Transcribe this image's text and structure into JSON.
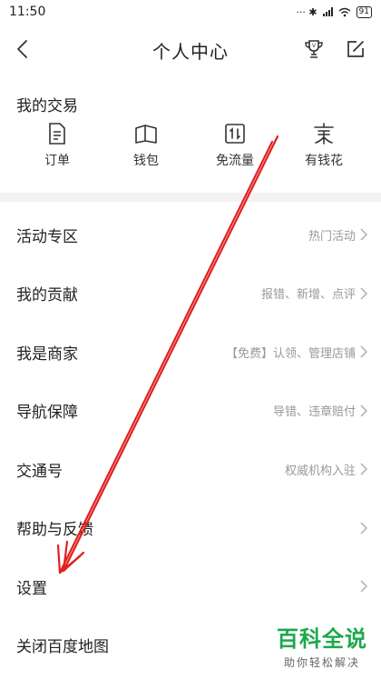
{
  "status_bar": {
    "time": "11:50",
    "icons_text": "··· ✱",
    "battery": "91"
  },
  "header": {
    "title": "个人中心",
    "back_icon": "back-arrow-icon",
    "trophy_icon": "trophy-icon",
    "edit_icon": "edit-icon"
  },
  "trade": {
    "title": "我的交易",
    "items": [
      {
        "label": "订单",
        "icon": "document-icon"
      },
      {
        "label": "钱包",
        "icon": "wallet-icon"
      },
      {
        "label": "免流量",
        "icon": "data-free-icon"
      },
      {
        "label": "有钱花",
        "icon": "youqianhua-icon"
      }
    ]
  },
  "menu": [
    {
      "label": "活动专区",
      "desc": "热门活动"
    },
    {
      "label": "我的贡献",
      "desc": "报错、新增、点评"
    },
    {
      "label": "我是商家",
      "desc": "【免费】认领、管理店铺"
    },
    {
      "label": "导航保障",
      "desc": "导错、违章赔付"
    },
    {
      "label": "交通号",
      "desc": "权威机构入驻"
    },
    {
      "label": "帮助与反馈",
      "desc": ""
    },
    {
      "label": "设置",
      "desc": ""
    },
    {
      "label": "关闭百度地图",
      "desc": ""
    }
  ],
  "watermark": {
    "main": "百科全说",
    "sub": "助你轻松解决"
  },
  "colors": {
    "annotation": "#e02020",
    "watermark": "#1ea84a",
    "divider": "#f2f2f4"
  }
}
